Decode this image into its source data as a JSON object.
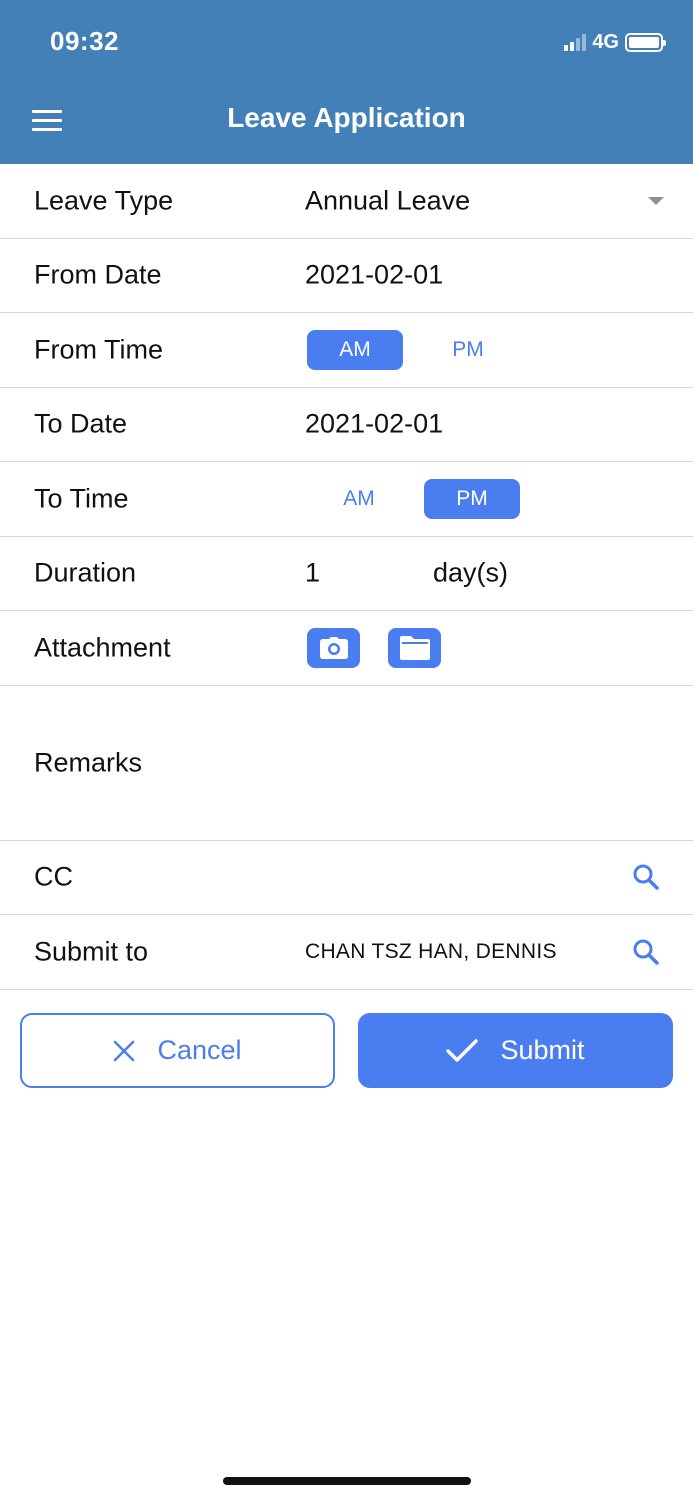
{
  "status_bar": {
    "time": "09:32",
    "network": "4G"
  },
  "header": {
    "title": "Leave Application",
    "menu_icon": "hamburger-menu-icon"
  },
  "form": {
    "leave_type": {
      "label": "Leave Type",
      "value": "Annual Leave"
    },
    "from_date": {
      "label": "From Date",
      "value": "2021-02-01"
    },
    "from_time": {
      "label": "From Time",
      "options": [
        "AM",
        "PM"
      ],
      "selected": "AM"
    },
    "to_date": {
      "label": "To Date",
      "value": "2021-02-01"
    },
    "to_time": {
      "label": "To Time",
      "options": [
        "AM",
        "PM"
      ],
      "selected": "PM"
    },
    "duration": {
      "label": "Duration",
      "value": "1",
      "unit": "day(s)"
    },
    "attachment": {
      "label": "Attachment",
      "icons": [
        "camera-icon",
        "folder-icon"
      ]
    },
    "remarks": {
      "label": "Remarks"
    },
    "cc": {
      "label": "CC",
      "icon": "search-icon"
    },
    "submit_to": {
      "label": "Submit to",
      "value": "CHAN TSZ HAN, DENNIS",
      "icon": "search-icon"
    }
  },
  "actions": {
    "cancel": {
      "label": "Cancel",
      "icon": "close-icon"
    },
    "submit": {
      "label": "Submit",
      "icon": "check-icon"
    }
  },
  "colors": {
    "header_bg": "#4380b7",
    "accent": "#4a7ef0",
    "divider": "#d6d6d6"
  }
}
